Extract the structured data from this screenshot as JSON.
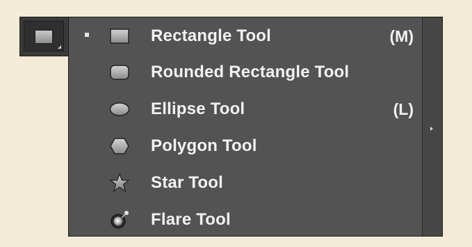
{
  "tool_well": {
    "icon": "rectangle-icon"
  },
  "flyout": {
    "items": [
      {
        "label": "Rectangle Tool",
        "shortcut": "(M)",
        "icon": "rectangle-icon",
        "active": true
      },
      {
        "label": "Rounded Rectangle Tool",
        "shortcut": "",
        "icon": "rounded-rectangle-icon",
        "active": false
      },
      {
        "label": "Ellipse Tool",
        "shortcut": "(L)",
        "icon": "ellipse-icon",
        "active": false
      },
      {
        "label": "Polygon Tool",
        "shortcut": "",
        "icon": "polygon-icon",
        "active": false
      },
      {
        "label": "Star Tool",
        "shortcut": "",
        "icon": "star-icon",
        "active": false
      },
      {
        "label": "Flare Tool",
        "shortcut": "",
        "icon": "flare-icon",
        "active": false
      }
    ]
  },
  "colors": {
    "panel_bg": "#535353",
    "text": "#f2f2f2",
    "page_bg": "#f3ead8"
  }
}
